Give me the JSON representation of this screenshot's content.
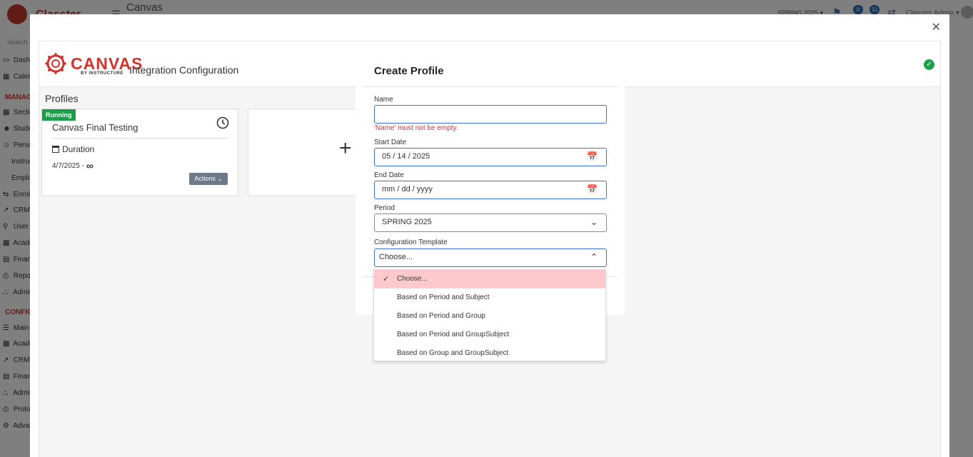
{
  "app": {
    "brand": "Classter",
    "page_title": "Canvas",
    "period_selector": "SPRING 2025",
    "notification_badge": "0",
    "message_badge": "11",
    "user_name": "Classter Admin",
    "search_placeholder": "Search"
  },
  "sidebar": {
    "items": [
      {
        "label": "Dashboard",
        "icon": "monitor-icon"
      },
      {
        "label": "Calendar",
        "icon": "calendar-icon"
      },
      {
        "label": "Sections",
        "icon": "sections-icon"
      },
      {
        "label": "Students",
        "icon": "students-icon"
      },
      {
        "label": "Personnel",
        "icon": "person-icon"
      },
      {
        "label": "Instructors",
        "icon": ""
      },
      {
        "label": "Employees",
        "icon": ""
      },
      {
        "label": "Enrollment",
        "icon": "enroll-icon"
      },
      {
        "label": "CRM",
        "icon": "crm-icon"
      },
      {
        "label": "User Accounts",
        "icon": "key-icon"
      },
      {
        "label": "Academics",
        "icon": "academics-icon"
      },
      {
        "label": "Financial",
        "icon": "finance-icon"
      },
      {
        "label": "Reports",
        "icon": "printer-icon"
      },
      {
        "label": "Administration",
        "icon": "bank-icon"
      },
      {
        "label": "Main Settings",
        "icon": "sliders-icon"
      },
      {
        "label": "Academic Settings",
        "icon": "academics-icon"
      },
      {
        "label": "CRM Settings",
        "icon": "crm-icon"
      },
      {
        "label": "Financial Settings",
        "icon": "finance-icon"
      },
      {
        "label": "Administration Settings",
        "icon": "bank-icon"
      },
      {
        "label": "Protocol",
        "icon": "protocol-icon"
      },
      {
        "label": "Advanced",
        "icon": "gear-icon"
      }
    ],
    "section_manage": "MANAGE",
    "section_config": "CONFIGURATION"
  },
  "integration": {
    "logo_word": "CANVAS",
    "logo_sub": "BY INSTRUCTURE",
    "title": "Integration Configuration",
    "profiles_heading": "Profiles",
    "profile_card": {
      "status": "Running",
      "name": "Canvas Final Testing",
      "duration_label": "Duration",
      "start_date": "4/7/2025 -",
      "end_symbol": "∞",
      "actions_label": "Actions"
    },
    "add_symbol": "+"
  },
  "dialog": {
    "title": "Create Profile",
    "name_label": "Name",
    "name_value": "",
    "name_error": "'Name' must not be empty.",
    "start_label": "Start Date",
    "start_value": "05 / 14 / 2025",
    "end_label": "End Date",
    "end_value": "mm / dd / yyyy",
    "period_label": "Period",
    "period_value": "SPRING 2025",
    "template_label": "Configuration Template",
    "template_value": "Choose..."
  },
  "dropdown": {
    "options": [
      "Choose...",
      "Based on Period and Subject",
      "Based on Period and Group",
      "Based on Period and GroupSubject",
      "Based on Group and GroupSubject"
    ],
    "selected_index": 0
  },
  "colors": {
    "focus_border": "#3b6fd1",
    "error": "#d9303b",
    "selected_option": "#fdc9cd",
    "running": "#1e9e4a",
    "canvas_red": "#d0342c"
  }
}
